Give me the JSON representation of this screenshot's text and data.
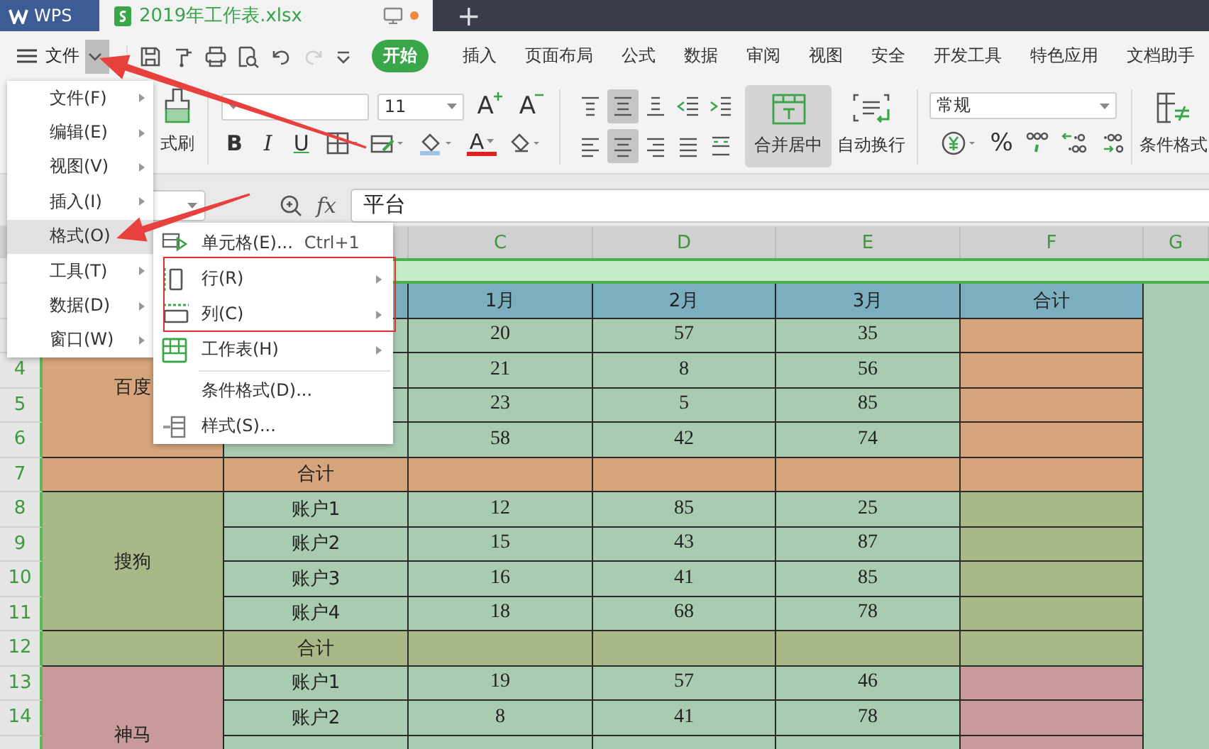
{
  "title_bar": {
    "app_tab": "WPS",
    "document_tab": {
      "title": "2019年工作表.xlsx",
      "unsaved": true
    },
    "new_tab": "+"
  },
  "menu_bar": {
    "file_label": "文件",
    "file_dropdown_pressed": true,
    "redo_disabled": true,
    "tabs": [
      {
        "label": "开始",
        "selected": true
      },
      {
        "label": "插入",
        "selected": false
      },
      {
        "label": "页面布局",
        "selected": false
      },
      {
        "label": "公式",
        "selected": false
      },
      {
        "label": "数据",
        "selected": false
      },
      {
        "label": "审阅",
        "selected": false
      },
      {
        "label": "视图",
        "selected": false
      },
      {
        "label": "安全",
        "selected": false
      },
      {
        "label": "开发工具",
        "selected": false
      },
      {
        "label": "特色应用",
        "selected": false
      },
      {
        "label": "文档助手",
        "selected": false
      }
    ]
  },
  "ribbon": {
    "format_painter": "式刷",
    "font_size": "11",
    "grow_font": "A",
    "shrink_font": "A",
    "bold": "B",
    "italic": "I",
    "underline": "U",
    "font_color": "A",
    "align_buttons": [
      {
        "kind": "top",
        "pressed": false
      },
      {
        "kind": "middle",
        "pressed": true
      },
      {
        "kind": "bottom",
        "pressed": false
      },
      {
        "kind": "outdent",
        "pressed": false
      },
      {
        "kind": "indent",
        "pressed": false
      },
      {
        "kind": "left",
        "pressed": false
      },
      {
        "kind": "center",
        "pressed": true
      },
      {
        "kind": "right",
        "pressed": false
      },
      {
        "kind": "justify",
        "pressed": false
      },
      {
        "kind": "distribute",
        "pressed": false
      }
    ],
    "merge_center": "合并居中",
    "merge_pressed": true,
    "wrap_text": "自动换行",
    "number_format": "常规",
    "percent": "%",
    "conditional_format": "条件格式"
  },
  "formula_bar": {
    "function_label": "fx",
    "value": "平台"
  },
  "sheet": {
    "columns": [
      "C",
      "D",
      "E",
      "F",
      "G"
    ],
    "highlighted_row": true,
    "header": [
      "1月",
      "2月",
      "3月",
      "合计"
    ],
    "groups": [
      {
        "name": "百度",
        "color": "#d6a57b",
        "accounts": [
          {
            "values": [
              "20",
              "57",
              "35"
            ]
          },
          {
            "number": "4",
            "values": [
              "21",
              "8",
              "56"
            ]
          },
          {
            "number": "5",
            "values": [
              "23",
              "5",
              "85"
            ]
          },
          {
            "number": "6",
            "values": [
              "58",
              "42",
              "74"
            ]
          }
        ],
        "total": {
          "number": "7",
          "label": "合计"
        }
      },
      {
        "name": "搜狗",
        "color": "#a8b886",
        "accounts": [
          {
            "number": "8",
            "label": "账户1",
            "values": [
              "12",
              "85",
              "25"
            ]
          },
          {
            "number": "9",
            "label": "账户2",
            "values": [
              "15",
              "43",
              "87"
            ]
          },
          {
            "number": "10",
            "label": "账户3",
            "values": [
              "16",
              "41",
              "85"
            ]
          },
          {
            "number": "11",
            "label": "账户4",
            "values": [
              "18",
              "68",
              "78"
            ]
          }
        ],
        "total": {
          "number": "12",
          "label": "合计"
        }
      },
      {
        "name": "神马",
        "color": "#c89a9a",
        "accounts": [
          {
            "number": "13",
            "label": "账户1",
            "values": [
              "19",
              "57",
              "46"
            ]
          },
          {
            "number": "14",
            "label": "账户2",
            "values": [
              "8",
              "41",
              "78"
            ]
          }
        ],
        "continues": true
      }
    ]
  },
  "file_menu": {
    "items": [
      {
        "label": "文件(F)",
        "selected": false,
        "has_submenu": true
      },
      {
        "label": "编辑(E)",
        "selected": false,
        "has_submenu": true
      },
      {
        "label": "视图(V)",
        "selected": false,
        "has_submenu": true
      },
      {
        "label": "插入(I)",
        "selected": false,
        "has_submenu": true
      },
      {
        "label": "格式(O)",
        "selected": true,
        "has_submenu": true
      },
      {
        "label": "工具(T)",
        "selected": false,
        "has_submenu": true
      },
      {
        "label": "数据(D)",
        "selected": false,
        "has_submenu": true
      },
      {
        "label": "窗口(W)",
        "selected": false,
        "has_submenu": true
      }
    ]
  },
  "format_submenu": {
    "items": [
      {
        "kind": "cell",
        "label": "单元格(E)...",
        "shortcut": "Ctrl+1",
        "has_submenu": false
      },
      {
        "kind": "row",
        "label": "行(R)",
        "has_submenu": true
      },
      {
        "kind": "column",
        "label": "列(C)",
        "has_submenu": true
      },
      {
        "kind": "sheet",
        "label": "工作表(H)",
        "has_submenu": true
      },
      {
        "kind": "separator"
      },
      {
        "kind": "plain",
        "label": "条件格式(D)...",
        "has_submenu": false
      },
      {
        "kind": "style",
        "label": "样式(S)...",
        "has_submenu": false
      }
    ]
  }
}
